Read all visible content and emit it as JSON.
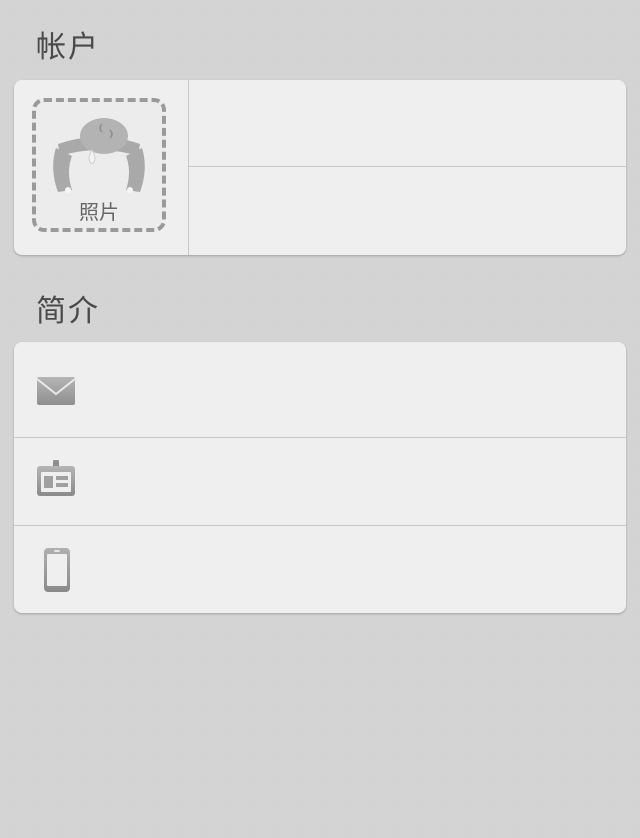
{
  "account_section": {
    "title": "帐户",
    "photo_label": "照片"
  },
  "profile_section": {
    "title": "简介"
  },
  "icons": {
    "avatar": "avatar-placeholder-icon",
    "email": "envelope-icon",
    "id": "id-card-icon",
    "phone": "mobile-phone-icon"
  },
  "colors": {
    "background": "#d3d3d3",
    "card": "#efefef",
    "text": "#4a4a4a"
  }
}
